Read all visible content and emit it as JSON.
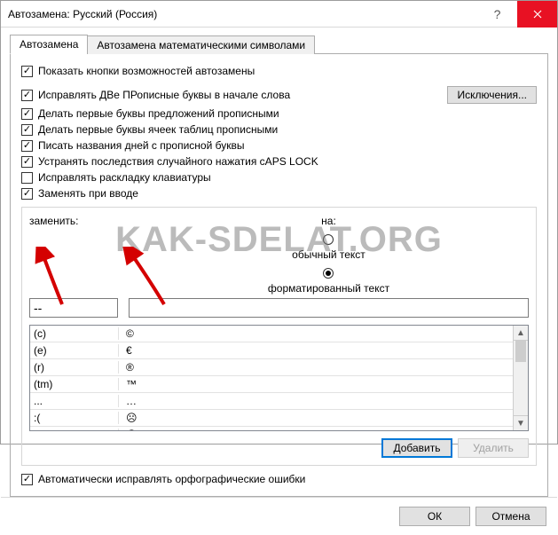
{
  "window": {
    "title": "Автозамена: Русский (Россия)"
  },
  "tabs": {
    "autocorrect": "Автозамена",
    "math": "Автозамена математическими символами"
  },
  "options": {
    "show_buttons": "Показать кнопки возможностей автозамены",
    "two_initial_caps": "Исправлять ДВе ПРописные буквы в начале слова",
    "cap_first_sentence": "Делать первые буквы предложений прописными",
    "cap_first_cells": "Делать первые буквы ячеек таблиц прописными",
    "cap_days": "Писать названия дней с прописной буквы",
    "caps_lock": "Устранять последствия случайного нажатия cAPS LOCK",
    "keyboard_layout": "Исправлять раскладку клавиатуры",
    "replace_on_type": "Заменять при вводе"
  },
  "buttons": {
    "exceptions": "Исключения...",
    "add": "Добавить",
    "delete": "Удалить",
    "ok": "ОК",
    "cancel": "Отмена"
  },
  "replace_section": {
    "replace_label": "заменить:",
    "with_label": "на:",
    "plain_text": "обычный текст",
    "formatted_text": "форматированный текст",
    "replace_value": "--",
    "with_value": ""
  },
  "table": [
    {
      "from": "(c)",
      "to": "©"
    },
    {
      "from": "(e)",
      "to": "€"
    },
    {
      "from": "(r)",
      "to": "®"
    },
    {
      "from": "(tm)",
      "to": "™"
    },
    {
      "from": "...",
      "to": "…"
    },
    {
      "from": ":(",
      "to": "☹"
    },
    {
      "from": ":-(",
      "to": "☹"
    }
  ],
  "bottom_check": "Автоматически исправлять орфографические ошибки",
  "watermark": "KAK-SDELAT.ORG"
}
